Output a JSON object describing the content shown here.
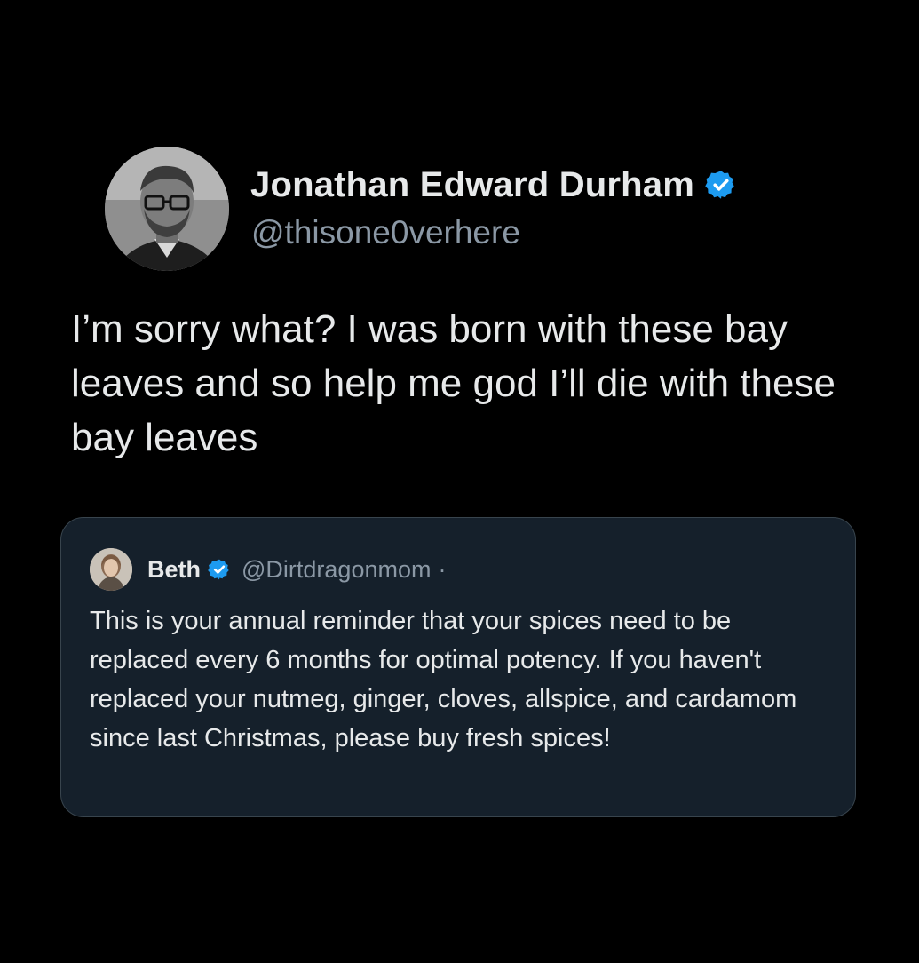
{
  "tweet": {
    "display_name": "Jonathan Edward Durham",
    "handle": "@thisone0verhere",
    "verified": true,
    "text": "I’m sorry what? I was born with these bay leaves and so help me god I’ll die with these bay leaves"
  },
  "quoted_tweet": {
    "display_name": "Beth",
    "handle": "@Dirtdragonmom",
    "separator": "·",
    "verified": true,
    "text": "This is your annual reminder that your spices need to be replaced every 6 months for optimal potency. If you haven't replaced your nutmeg, ginger, cloves, allspice, and cardamom since last Christmas, please buy fresh spices!"
  },
  "colors": {
    "background": "#000000",
    "text_primary": "#e7e9ea",
    "text_secondary": "#8b98a5",
    "quote_background": "#15202b",
    "quote_border": "#38444d",
    "verified_badge": "#1d9bf0"
  },
  "icons": {
    "verified": "verified-badge-icon",
    "avatar": "user-avatar",
    "quote_avatar": "quote-user-avatar"
  }
}
